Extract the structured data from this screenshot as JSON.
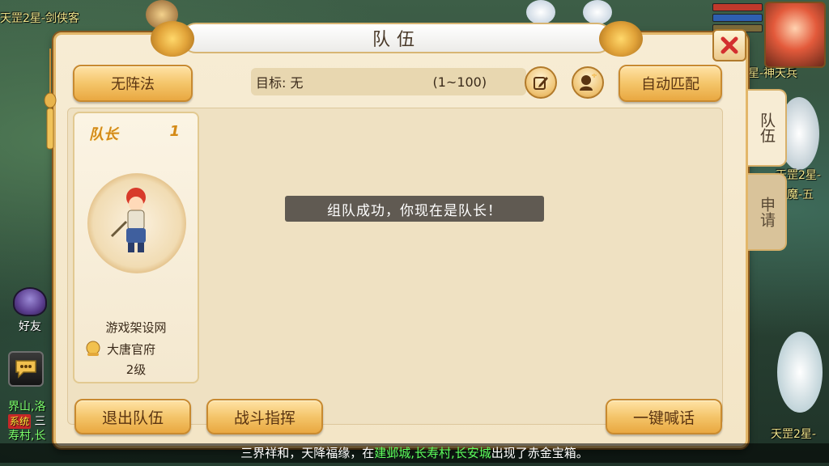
{
  "world": {
    "labels": [
      {
        "text": "天罡2星-剑侠客"
      },
      {
        "text": "星-神天兵"
      },
      {
        "text": "天罡2星-"
      },
      {
        "text": "魔-五"
      },
      {
        "text": "天罡2星-"
      }
    ],
    "friend_label": "好友",
    "left_log": [
      {
        "text": "界山,洛"
      },
      {
        "tag": "系统",
        "text": "三"
      },
      {
        "text": "寿村,长"
      }
    ]
  },
  "panel": {
    "title": "队伍",
    "formation_button": "无阵法",
    "target_label": "目标: 无",
    "target_range": "(1~100)",
    "auto_match_button": "自动匹配",
    "leave_team_button": "退出队伍",
    "battle_command_button": "战斗指挥",
    "shout_button": "一键喊话",
    "toast": "组队成功，你现在是队长！"
  },
  "member": {
    "role": "队长",
    "index": "1",
    "name": "游戏架设网",
    "school": "大唐官府",
    "level": "2级"
  },
  "side_tabs": {
    "team": "队伍",
    "apply": "申请"
  },
  "marquee": {
    "prefix": "三界祥和，天降福缘，在",
    "places": "建邺城,长寿村,长安城",
    "suffix": "出现了赤金宝箱。"
  },
  "colors": {
    "panel_bg": "#f7ecd4",
    "button_gold": "#f4c56a",
    "button_text": "#5a3412",
    "accent_orange": "#d48a16",
    "highlight_green": "#5dff5d",
    "close_red": "#d32f2f"
  }
}
